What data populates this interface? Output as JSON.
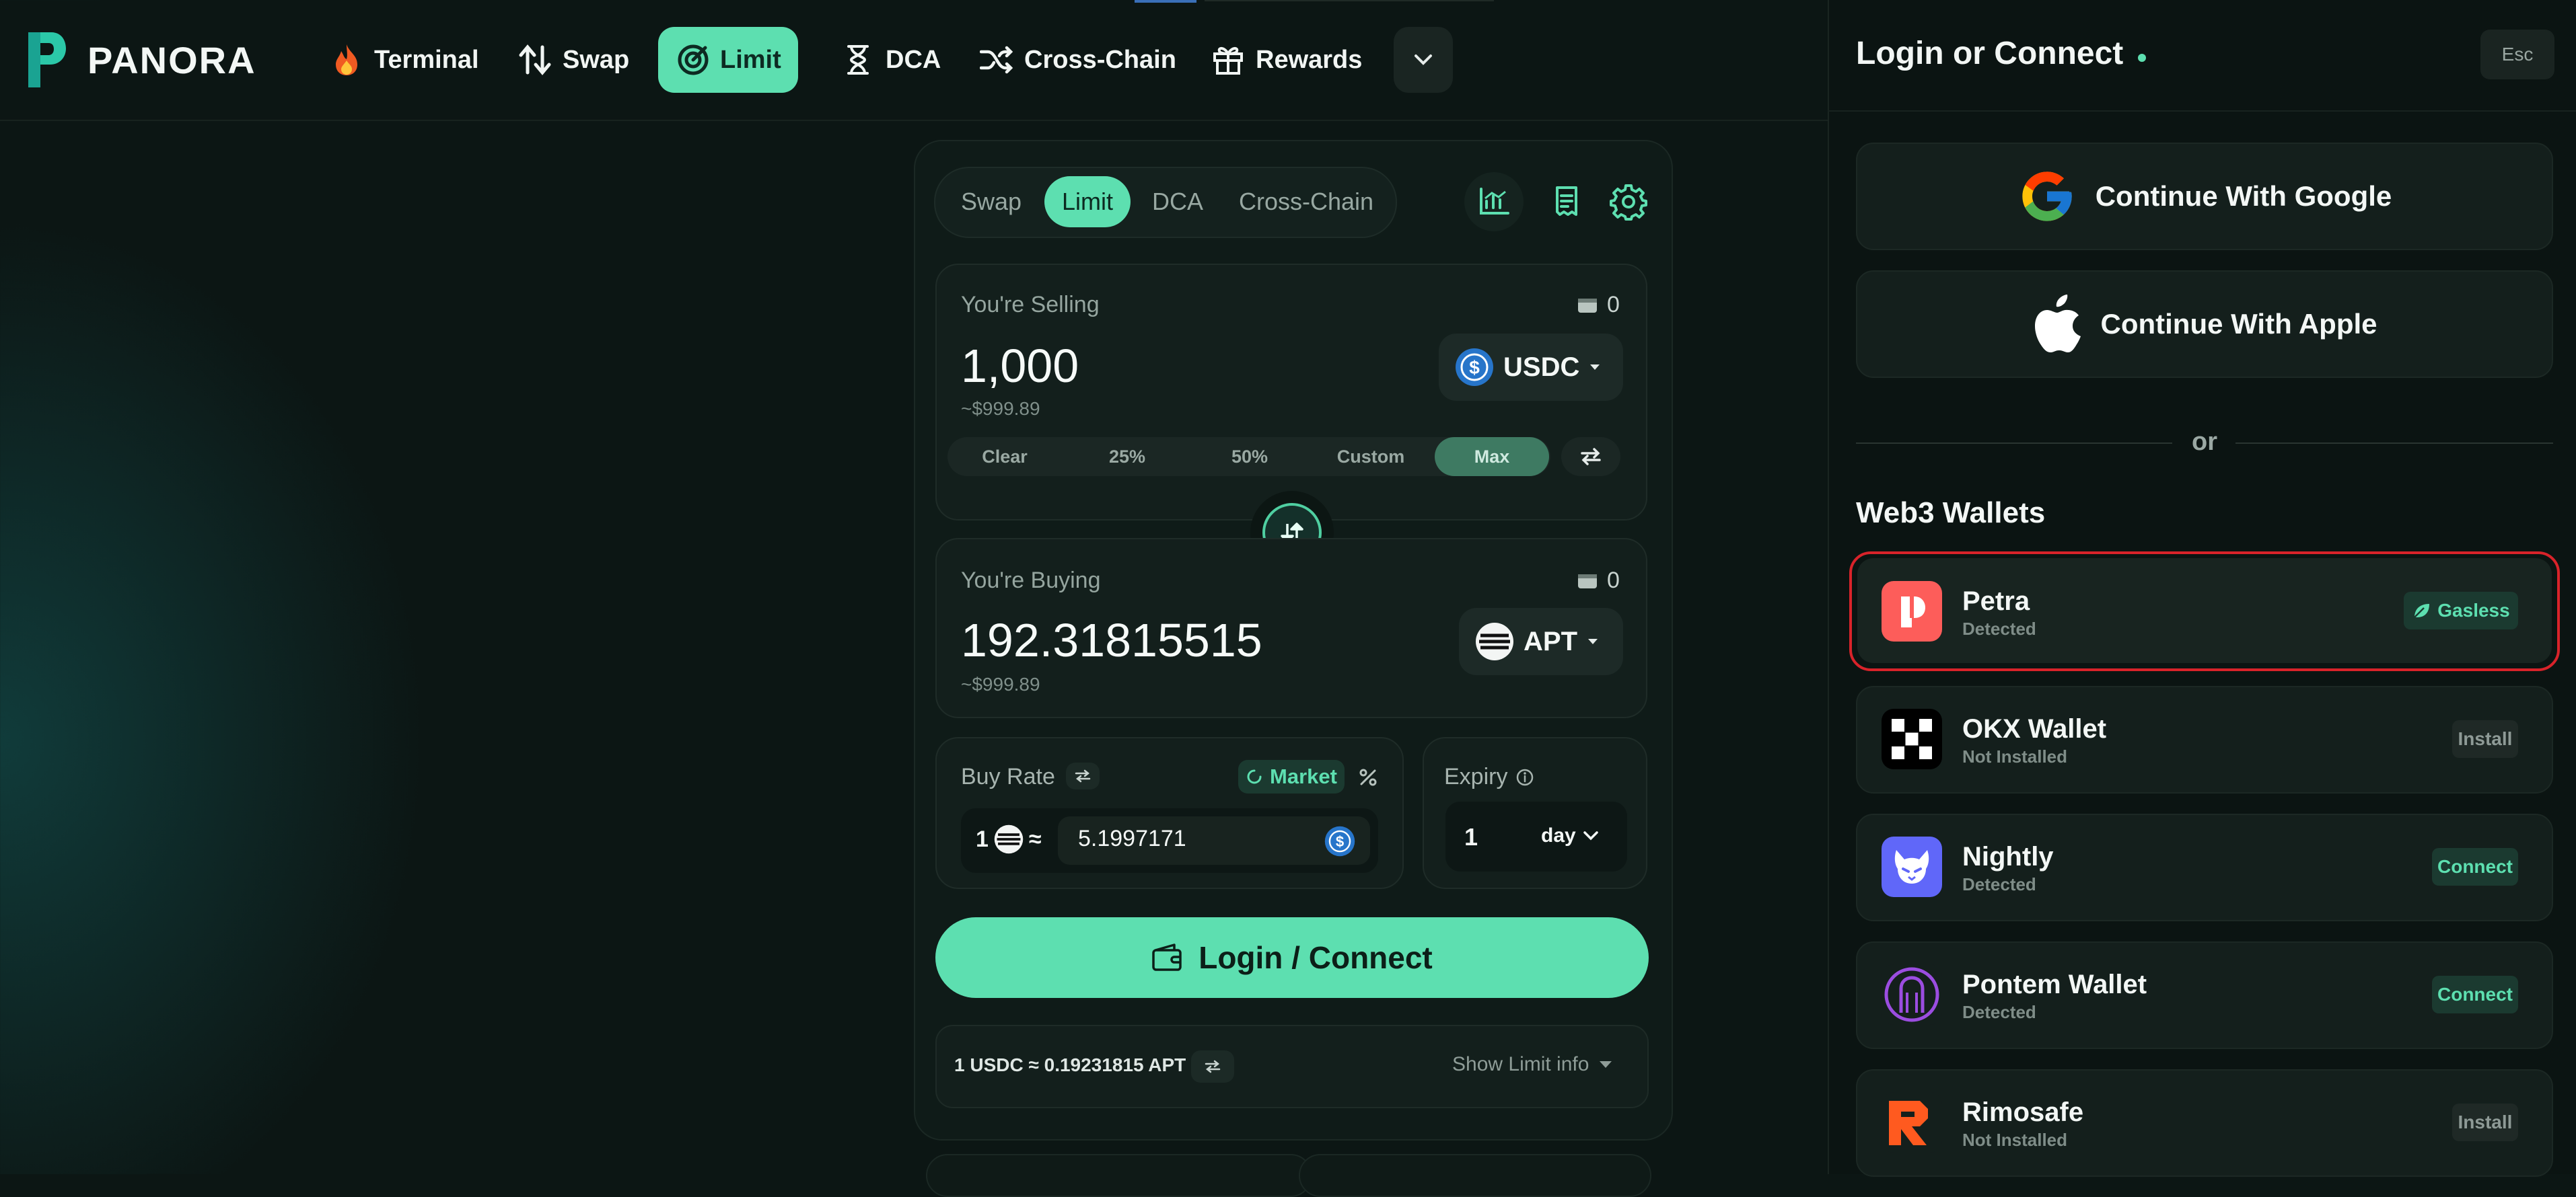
{
  "nav": {
    "brand": "PANORA",
    "items": [
      {
        "label": "Terminal",
        "icon": "fire-icon"
      },
      {
        "label": "Swap",
        "icon": "swap-arrows-icon"
      },
      {
        "label": "Limit",
        "icon": "target-icon",
        "active": true
      },
      {
        "label": "DCA",
        "icon": "hourglass-icon"
      },
      {
        "label": "Cross-Chain",
        "icon": "shuffle-icon"
      },
      {
        "label": "Rewards",
        "icon": "gift-icon"
      }
    ],
    "more_icon": "chevron-down-icon"
  },
  "trade": {
    "tabs": [
      "Swap",
      "Limit",
      "DCA",
      "Cross-Chain"
    ],
    "active_tab": "Limit",
    "icons": [
      "chart-icon",
      "receipt-icon",
      "gear-icon"
    ],
    "selling": {
      "label": "You're Selling",
      "balance": "0",
      "amount": "1,000",
      "usd": "~$999.89",
      "token": "USDC"
    },
    "percent_buttons": [
      "Clear",
      "25%",
      "50%",
      "Custom",
      "Max"
    ],
    "active_percent": "Max",
    "buying": {
      "label": "You're Buying",
      "balance": "0",
      "amount": "192.31815515",
      "usd": "~$999.89",
      "token": "APT"
    },
    "buy_rate": {
      "label": "Buy Rate",
      "market": "Market",
      "base_amount": "1",
      "approx": "≈",
      "value": "5.1997171"
    },
    "expiry": {
      "label": "Expiry",
      "value": "1",
      "unit": "day"
    },
    "login_button": "Login / Connect",
    "rate_summary": "1 USDC ≈ 0.19231815 APT",
    "show_limit_info": "Show Limit info"
  },
  "sidebar": {
    "title": "Login or Connect",
    "esc": "Esc",
    "google": "Continue With Google",
    "apple": "Continue With Apple",
    "or": "or",
    "section": "Web3 Wallets",
    "wallets": [
      {
        "name": "Petra",
        "status": "Detected",
        "badge": "Gasless"
      },
      {
        "name": "OKX Wallet",
        "status": "Not Installed",
        "badge": "Install"
      },
      {
        "name": "Nightly",
        "status": "Detected",
        "badge": "Connect"
      },
      {
        "name": "Pontem Wallet",
        "status": "Detected",
        "badge": "Connect"
      },
      {
        "name": "Rimosafe",
        "status": "Not Installed",
        "badge": "Install"
      }
    ]
  },
  "colors": {
    "accent": "#5ddfb0",
    "background": "#0c1614",
    "highlight_border": "#d8232a"
  }
}
